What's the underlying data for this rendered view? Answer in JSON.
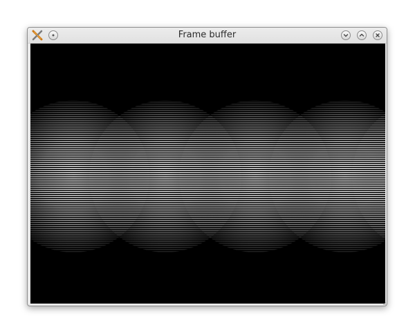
{
  "window": {
    "title": "Frame buffer"
  },
  "icons": {
    "app": "app-icon",
    "menu": "window-menu-icon",
    "minimize": "minimize-icon",
    "maximize": "maximize-icon",
    "close": "close-icon"
  },
  "colors": {
    "titlebar": "#e4e4e4",
    "canvas_background": "#000000",
    "line_color": "#ffffff"
  }
}
